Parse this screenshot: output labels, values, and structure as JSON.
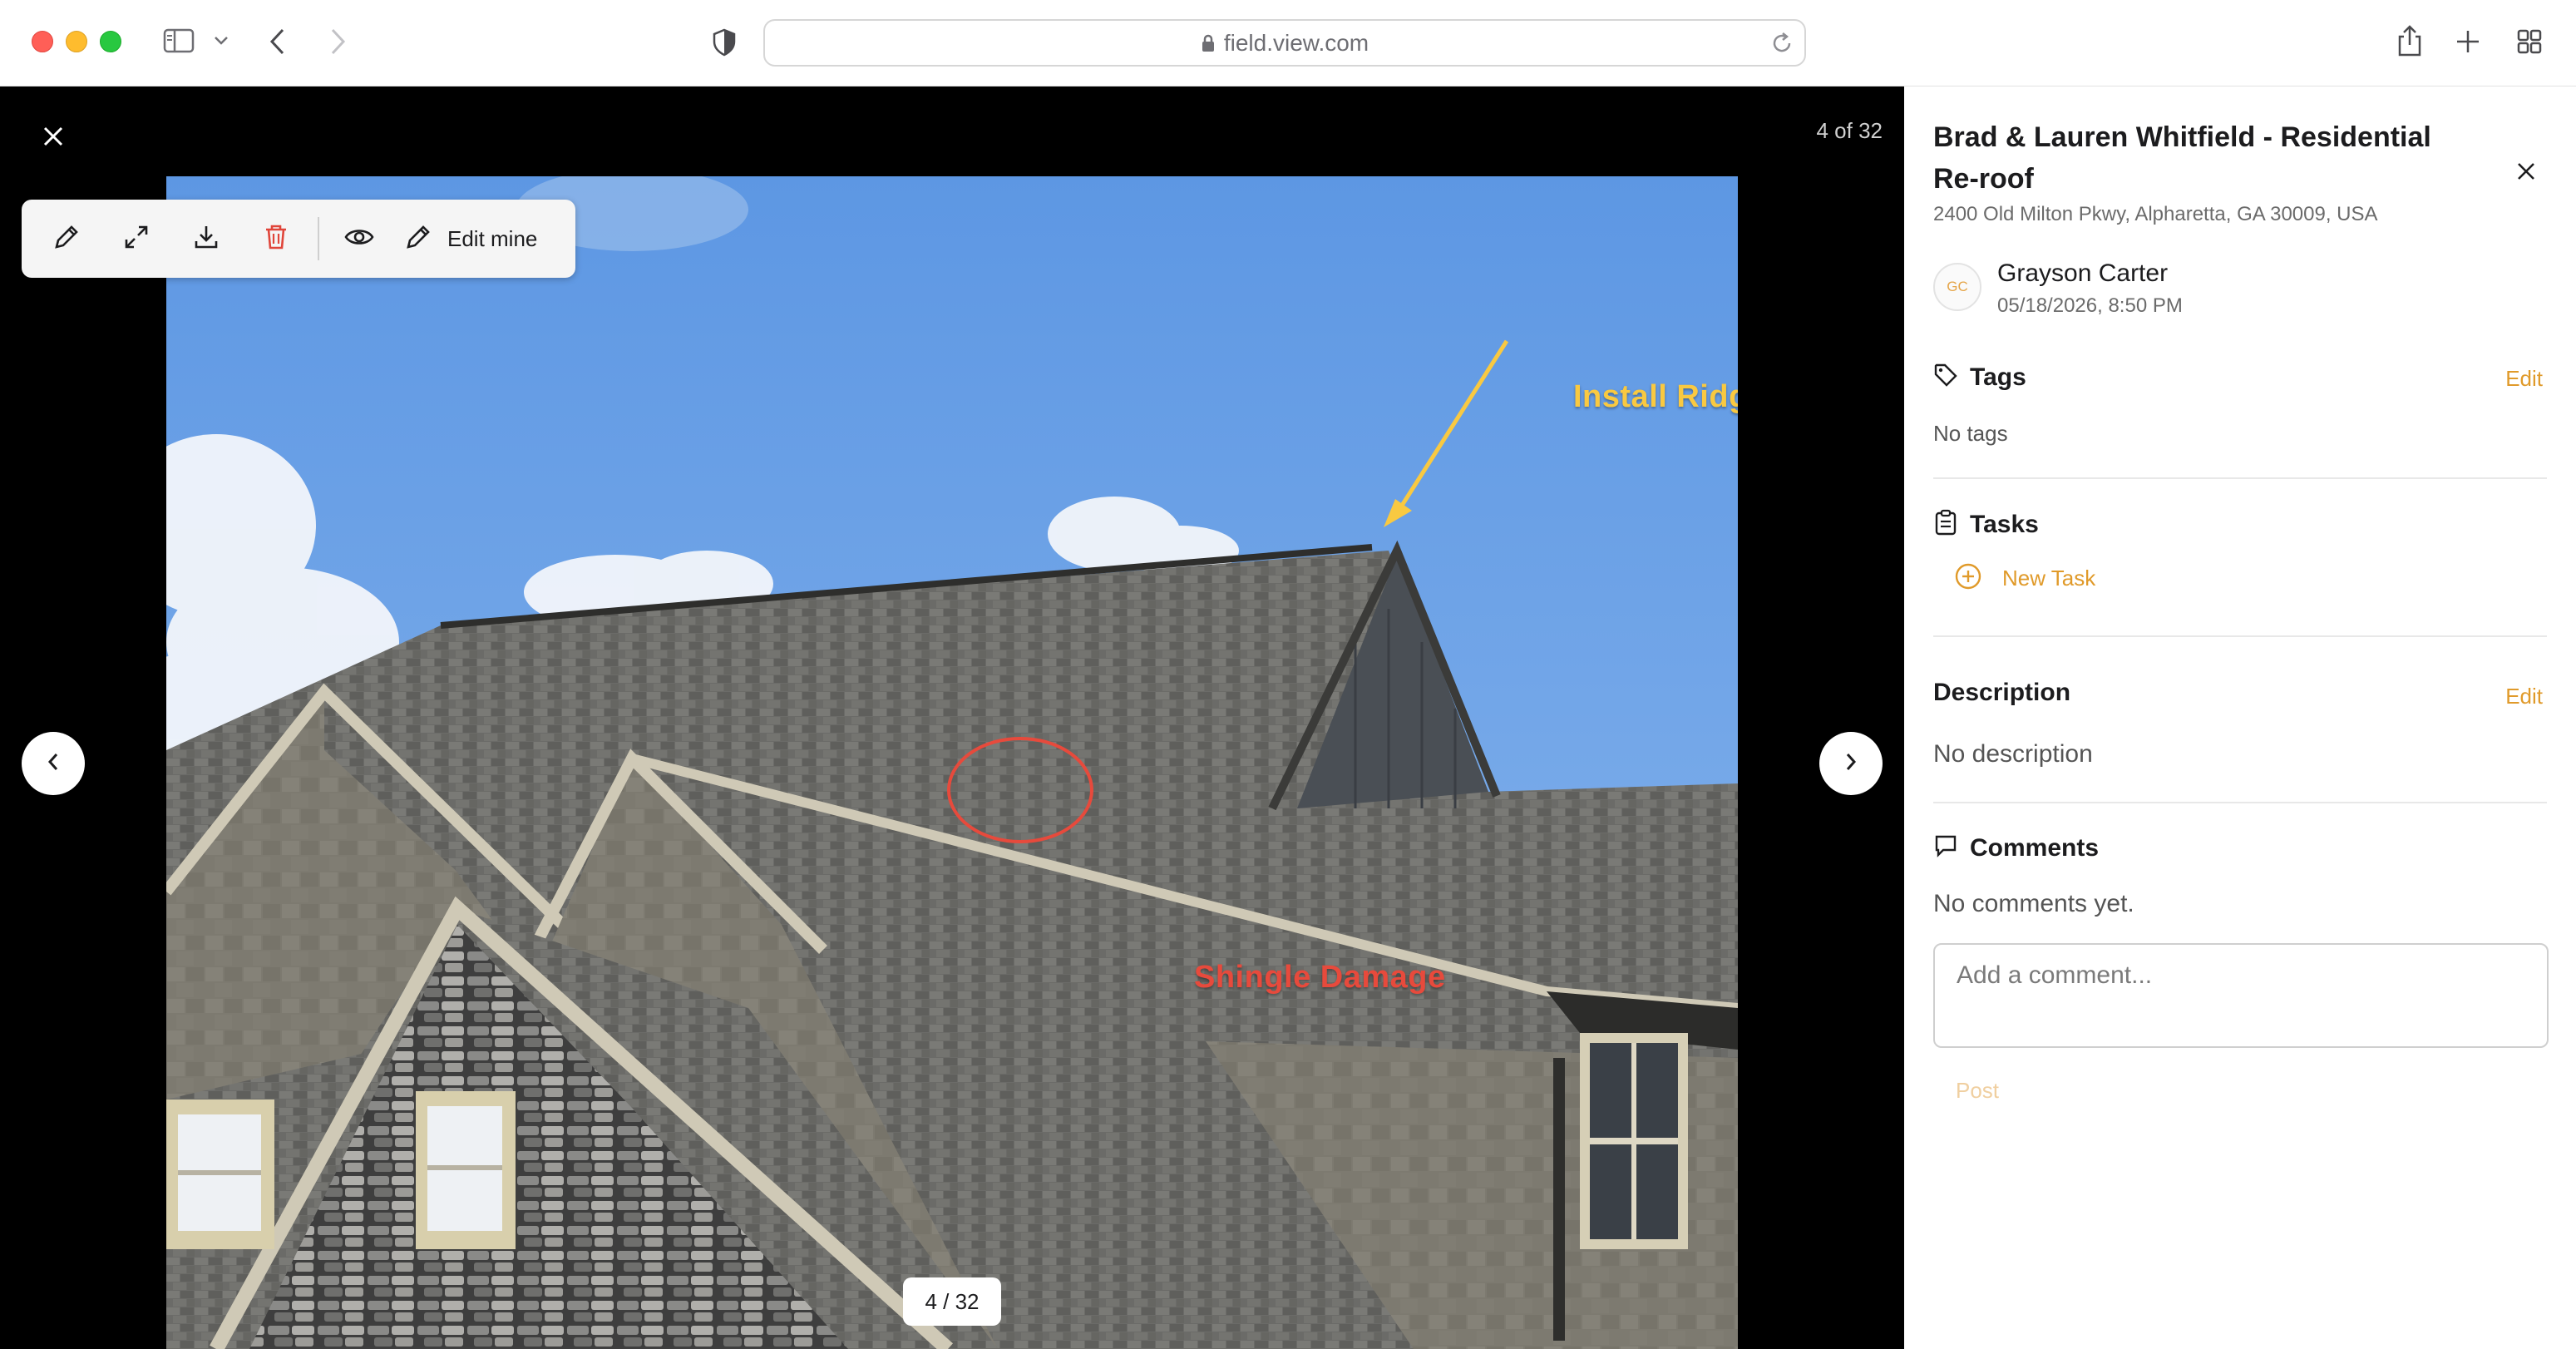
{
  "browser": {
    "url": "field.view.com",
    "icons": [
      "sidebar-toggle-icon",
      "chevron-down-icon",
      "back-arrow-icon",
      "forward-arrow-icon",
      "shield-icon",
      "lock-icon",
      "reload-icon",
      "share-icon",
      "new-tab-plus-icon",
      "tab-overview-icon"
    ]
  },
  "viewer": {
    "counter_text": "4 of 32",
    "pager_text": "4 / 32",
    "annotations": {
      "ridge_label": "Install Ridge Cap",
      "damage_label": "Shingle Damage"
    },
    "toolbar": {
      "edit_mine_label": "Edit mine",
      "icons": [
        "pencil-icon",
        "expand-icon",
        "download-icon",
        "trash-icon",
        "eye-icon",
        "pencil-icon"
      ]
    },
    "colors": {
      "annotation_yellow": "#f9c941",
      "annotation_red": "#e74a3c",
      "delete_red": "#e0453a"
    }
  },
  "panel": {
    "title": "Brad & Lauren Whitfield - Residential Re-roof",
    "address": "2400 Old Milton Pkwy, Alpharetta, GA 30009, USA",
    "author": {
      "initials": "GC",
      "name": "Grayson Carter",
      "date": "05/18/2026, 8:50 PM"
    },
    "tags": {
      "heading": "Tags",
      "edit_label": "Edit",
      "empty_text": "No tags"
    },
    "tasks": {
      "heading": "Tasks",
      "new_task_label": "New Task"
    },
    "description": {
      "heading": "Description",
      "edit_label": "Edit",
      "empty_text": "No description"
    },
    "comments": {
      "heading": "Comments",
      "empty_text": "No comments yet.",
      "input_placeholder": "Add a comment...",
      "post_label": "Post"
    },
    "accent_color": "#e09a2a"
  }
}
